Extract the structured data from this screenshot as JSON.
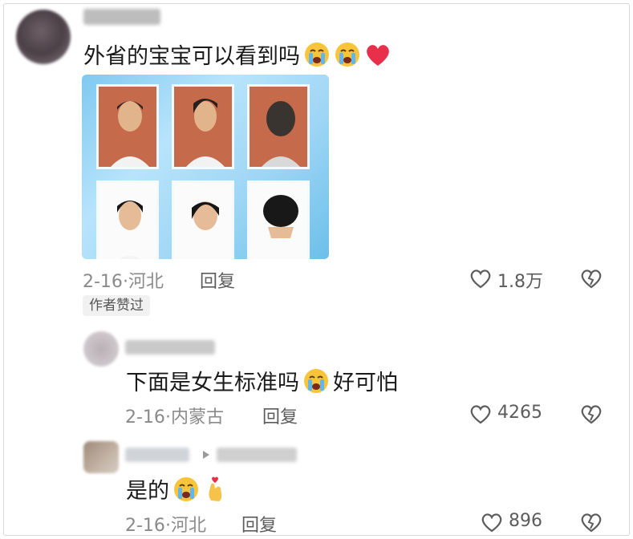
{
  "comments": [
    {
      "text": "外省的宝宝可以看到吗",
      "date": "2-16",
      "location": "河北",
      "reply_label": "回复",
      "likes": "1.8万",
      "badge": "作者赞过"
    },
    {
      "text": "下面是女生标准吗",
      "text_after_emoji": "好可怕",
      "date": "2-16",
      "location": "内蒙古",
      "reply_label": "回复",
      "likes": "4265"
    },
    {
      "text": "是的",
      "date": "2-16",
      "location": "河北",
      "reply_label": "回复",
      "likes": "896"
    }
  ],
  "meta_separator": "·",
  "icons": {
    "like": "heart-outline-icon",
    "dislike": "broken-heart-icon",
    "crying": "crying-face-emoji",
    "heart": "red-heart-emoji",
    "finger_heart": "finger-heart-emoji"
  },
  "colors": {
    "text": "#1a1a1a",
    "meta": "#8a8a8a",
    "action": "#5c5c5c",
    "emoji_red": "#e8304a",
    "panel_blue": "#9fd6f5"
  }
}
